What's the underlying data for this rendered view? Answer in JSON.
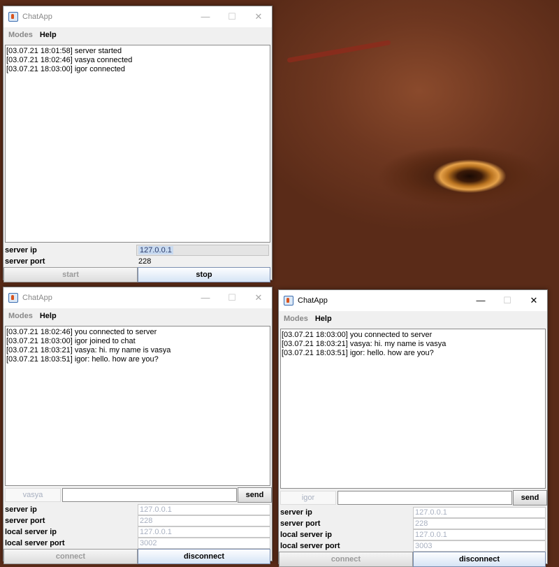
{
  "app_title": "ChatApp",
  "menus": {
    "modes": "Modes",
    "help": "Help"
  },
  "window_controls": {
    "minimize": "—",
    "maximize": "☐",
    "close": "✕"
  },
  "server_window": {
    "log": [
      "[03.07.21 18:01:58] server started",
      "[03.07.21 18:02:46] vasya connected",
      "[03.07.21 18:03:00] igor connected"
    ],
    "fields": {
      "server_ip_label": "server ip",
      "server_ip": "127.0.0.1",
      "server_port_label": "server port",
      "server_port": "228"
    },
    "buttons": {
      "start": "start",
      "stop": "stop"
    }
  },
  "client_vasya": {
    "log": [
      "[03.07.21 18:02:46] you connected to server",
      "[03.07.21 18:03:00] igor joined to chat",
      "[03.07.21 18:03:21] vasya: hi. my name is vasya",
      "[03.07.21 18:03:51] igor: hello. how are you?"
    ],
    "name": "vasya",
    "message": "",
    "send": "send",
    "fields": {
      "server_ip_label": "server ip",
      "server_ip": "127.0.0.1",
      "server_port_label": "server port",
      "server_port": "228",
      "local_ip_label": "local server ip",
      "local_ip": "127.0.0.1",
      "local_port_label": "local server port",
      "local_port": "3002"
    },
    "buttons": {
      "connect": "connect",
      "disconnect": "disconnect"
    }
  },
  "client_igor": {
    "log": [
      "[03.07.21 18:03:00] you connected to server",
      "[03.07.21 18:03:21] vasya: hi. my name is vasya",
      "[03.07.21 18:03:51] igor: hello. how are you?"
    ],
    "name": "igor",
    "message": "",
    "send": "send",
    "fields": {
      "server_ip_label": "server ip",
      "server_ip": "127.0.0.1",
      "server_port_label": "server port",
      "server_port": "228",
      "local_ip_label": "local server ip",
      "local_ip": "127.0.0.1",
      "local_port_label": "local server port",
      "local_port": "3003"
    },
    "buttons": {
      "connect": "connect",
      "disconnect": "disconnect"
    }
  }
}
